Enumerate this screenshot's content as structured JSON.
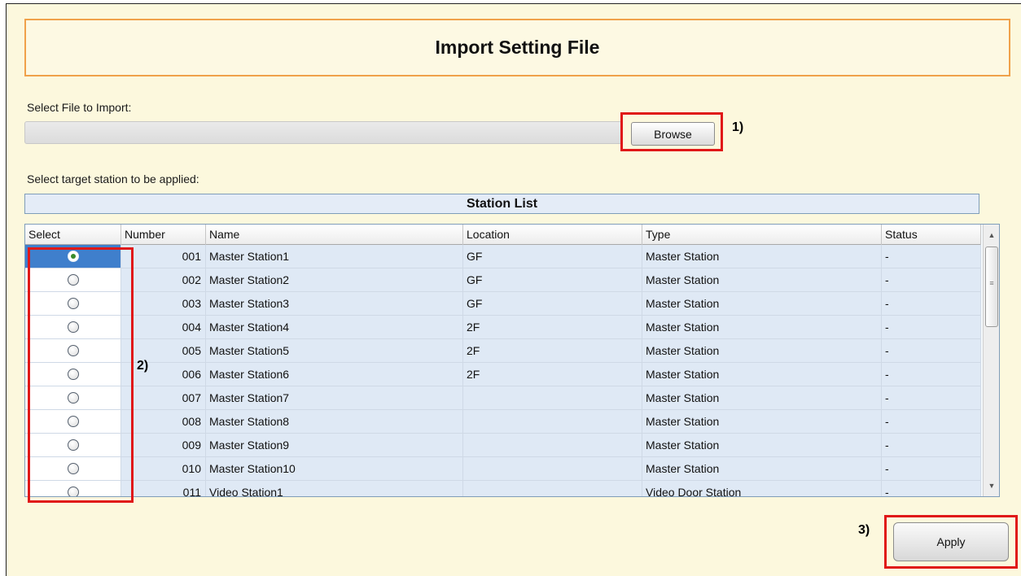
{
  "title": "Import Setting File",
  "file_section": {
    "label": "Select File to Import:",
    "value": "",
    "browse_label": "Browse"
  },
  "target_section": {
    "label": "Select target station to be applied:"
  },
  "station_list": {
    "title": "Station List",
    "columns": [
      "Select",
      "Number",
      "Name",
      "Location",
      "Type",
      "Status"
    ],
    "selected_index": 0,
    "rows": [
      {
        "number": "001",
        "name": "Master Station1",
        "location": "GF",
        "type": "Master Station",
        "status": "-"
      },
      {
        "number": "002",
        "name": "Master Station2",
        "location": "GF",
        "type": "Master Station",
        "status": "-"
      },
      {
        "number": "003",
        "name": "Master Station3",
        "location": "GF",
        "type": "Master Station",
        "status": "-"
      },
      {
        "number": "004",
        "name": "Master Station4",
        "location": "2F",
        "type": "Master Station",
        "status": "-"
      },
      {
        "number": "005",
        "name": "Master Station5",
        "location": "2F",
        "type": "Master Station",
        "status": "-"
      },
      {
        "number": "006",
        "name": "Master Station6",
        "location": "2F",
        "type": "Master Station",
        "status": "-"
      },
      {
        "number": "007",
        "name": "Master Station7",
        "location": "",
        "type": "Master Station",
        "status": "-"
      },
      {
        "number": "008",
        "name": "Master Station8",
        "location": "",
        "type": "Master Station",
        "status": "-"
      },
      {
        "number": "009",
        "name": "Master Station9",
        "location": "",
        "type": "Master Station",
        "status": "-"
      },
      {
        "number": "010",
        "name": "Master Station10",
        "location": "",
        "type": "Master Station",
        "status": "-"
      },
      {
        "number": "011",
        "name": "Video Station1",
        "location": "",
        "type": "Video Door Station",
        "status": "-"
      }
    ]
  },
  "annotations": {
    "a1": "1)",
    "a2": "2)",
    "a3": "3)"
  },
  "apply_label": "Apply",
  "colors": {
    "highlight": "#e01818",
    "title_border": "#f0a14a",
    "background": "#fcf8dd",
    "selected_row": "#3f7fcc"
  }
}
